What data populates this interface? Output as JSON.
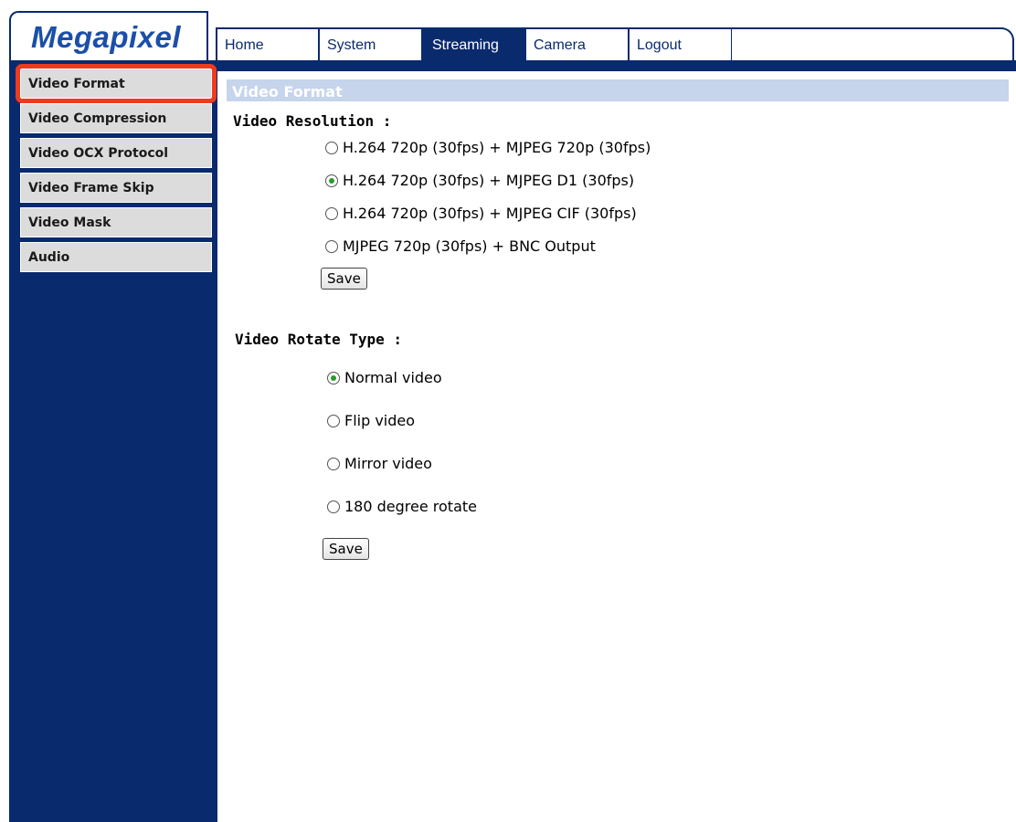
{
  "header": {
    "logo": "Megapixel",
    "nav": [
      "Home",
      "System",
      "Streaming",
      "Camera",
      "Logout"
    ],
    "active_nav": "Streaming"
  },
  "sidebar": {
    "items": [
      {
        "label": "Video Format"
      },
      {
        "label": "Video Compression"
      },
      {
        "label": "Video OCX Protocol"
      },
      {
        "label": "Video Frame Skip"
      },
      {
        "label": "Video Mask"
      },
      {
        "label": "Audio"
      }
    ],
    "highlight_color": "#ef3a1f"
  },
  "main": {
    "title": "Video Format",
    "resolution": {
      "label": "Video Resolution :",
      "options": [
        "H.264 720p (30fps) + MJPEG 720p (30fps)",
        "H.264 720p (30fps) + MJPEG D1 (30fps)",
        "H.264 720p (30fps) + MJPEG CIF (30fps)",
        "MJPEG 720p (30fps) + BNC Output"
      ],
      "selected_index": 1,
      "save_label": "Save"
    },
    "rotate": {
      "label": "Video Rotate Type :",
      "options": [
        "Normal video",
        "Flip video",
        "Mirror video",
        "180 degree rotate"
      ],
      "selected_index": 0,
      "save_label": "Save"
    }
  },
  "colors": {
    "navy": "#0a2a6e",
    "title_bar": "#c6d4ec",
    "sidebar_item": "#dcdcdc"
  }
}
